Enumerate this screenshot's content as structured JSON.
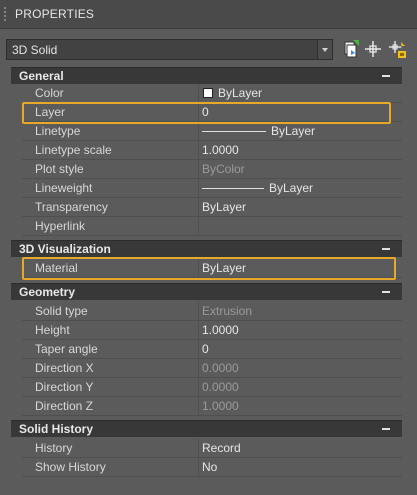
{
  "palette": {
    "title": "PROPERTIES"
  },
  "selector": {
    "value": "3D Solid"
  },
  "toolbar": {
    "buttons": [
      "toggle-pickadd-icon",
      "select-objects-icon",
      "quick-select-icon"
    ]
  },
  "sections": {
    "general": {
      "title": "General",
      "rows": {
        "color": {
          "label": "Color",
          "value": "ByLayer"
        },
        "layer": {
          "label": "Layer",
          "value": "0"
        },
        "linetype": {
          "label": "Linetype",
          "value": "ByLayer"
        },
        "linetype_scale": {
          "label": "Linetype scale",
          "value": "1.0000"
        },
        "plot_style": {
          "label": "Plot style",
          "value": "ByColor"
        },
        "lineweight": {
          "label": "Lineweight",
          "value": "ByLayer"
        },
        "transparency": {
          "label": "Transparency",
          "value": "ByLayer"
        },
        "hyperlink": {
          "label": "Hyperlink",
          "value": ""
        }
      }
    },
    "visualization": {
      "title": "3D Visualization",
      "rows": {
        "material": {
          "label": "Material",
          "value": "ByLayer"
        }
      }
    },
    "geometry": {
      "title": "Geometry",
      "rows": {
        "solid_type": {
          "label": "Solid type",
          "value": "Extrusion"
        },
        "height": {
          "label": "Height",
          "value": "1.0000"
        },
        "taper_angle": {
          "label": "Taper angle",
          "value": "0"
        },
        "direction_x": {
          "label": "Direction X",
          "value": "0.0000"
        },
        "direction_y": {
          "label": "Direction Y",
          "value": "0.0000"
        },
        "direction_z": {
          "label": "Direction Z",
          "value": "1.0000"
        }
      }
    },
    "solid_history": {
      "title": "Solid History",
      "rows": {
        "history": {
          "label": "History",
          "value": "Record"
        },
        "show_history": {
          "label": "Show History",
          "value": "No"
        }
      }
    }
  },
  "colors": {
    "highlight": "#e8a829",
    "color_swatch": "#ffffff"
  }
}
